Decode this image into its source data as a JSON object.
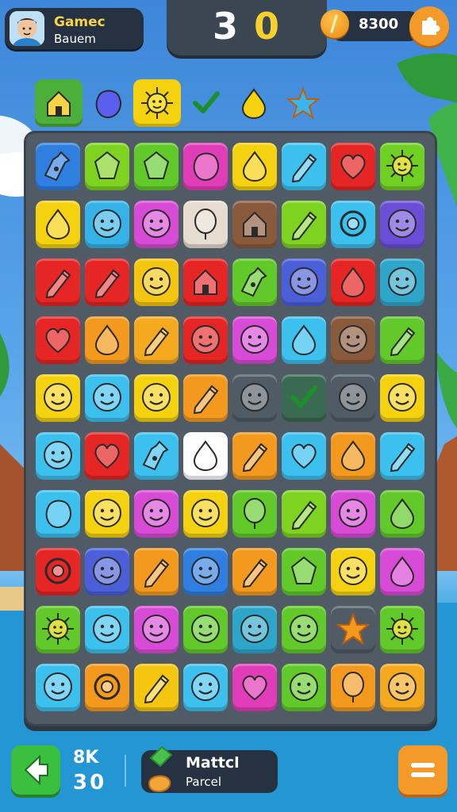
{
  "player": {
    "name": "Gamec",
    "subtitle": "Bauem"
  },
  "score": {
    "digit1": "3",
    "digit2": "0"
  },
  "coins": {
    "value": "8300"
  },
  "goals": [
    "house",
    "blob",
    "sun",
    "check",
    "drop",
    "star"
  ],
  "board": {
    "rows": [
      [
        {
          "c": "#2f7fe0",
          "i": "bottle"
        },
        {
          "c": "#7ed321",
          "i": "gem"
        },
        {
          "c": "#62c92a",
          "i": "gem"
        },
        {
          "c": "#e23db8",
          "i": "blob"
        },
        {
          "c": "#f5d20f",
          "i": "drop"
        },
        {
          "c": "#3cc0ee",
          "i": "pencil"
        },
        {
          "c": "#e62525",
          "i": "heart"
        },
        {
          "c": "#6fcf23",
          "i": "sun"
        }
      ],
      [
        {
          "c": "#f5d20f",
          "i": "drop"
        },
        {
          "c": "#35b3e8",
          "i": "face"
        },
        {
          "c": "#d84bd6",
          "i": "face"
        },
        {
          "c": "#e6dcd0",
          "i": "balloon"
        },
        {
          "c": "#8a5a3c",
          "i": "house"
        },
        {
          "c": "#7ed321",
          "i": "pencil"
        },
        {
          "c": "#3cc0ee",
          "i": "ring"
        },
        {
          "c": "#6a4ed8",
          "i": "face"
        }
      ],
      [
        {
          "c": "#e62525",
          "i": "pencil"
        },
        {
          "c": "#e62525",
          "i": "pencil"
        },
        {
          "c": "#f5c60f",
          "i": "face"
        },
        {
          "c": "#e62525",
          "i": "house"
        },
        {
          "c": "#62c92a",
          "i": "bottle"
        },
        {
          "c": "#4a5fd8",
          "i": "face"
        },
        {
          "c": "#e62525",
          "i": "drop"
        },
        {
          "c": "#2ea6c9",
          "i": "face"
        }
      ],
      [
        {
          "c": "#e62525",
          "i": "heart"
        },
        {
          "c": "#f39a1e",
          "i": "drop"
        },
        {
          "c": "#f5a91e",
          "i": "pencil"
        },
        {
          "c": "#e62525",
          "i": "face"
        },
        {
          "c": "#d84bd6",
          "i": "face"
        },
        {
          "c": "#3cc0ee",
          "i": "drop"
        },
        {
          "c": "#8a5a3c",
          "i": "face"
        },
        {
          "c": "#62c92a",
          "i": "pencil"
        }
      ],
      [
        {
          "c": "#f5d20f",
          "i": "face"
        },
        {
          "c": "#3cc0ee",
          "i": "face"
        },
        {
          "c": "#f5d20f",
          "i": "face"
        },
        {
          "c": "#f39a1e",
          "i": "pencil"
        },
        {
          "c": "#505b66",
          "i": "face"
        },
        {
          "c": "#3a6a52",
          "i": "check"
        },
        {
          "c": "#505b66",
          "i": "face"
        },
        {
          "c": "#f5d20f",
          "i": "face"
        }
      ],
      [
        {
          "c": "#3cc0ee",
          "i": "face"
        },
        {
          "c": "#e62525",
          "i": "heart"
        },
        {
          "c": "#3cc0ee",
          "i": "bottle"
        },
        {
          "c": "#ffffff",
          "i": "drop"
        },
        {
          "c": "#f39a1e",
          "i": "pencil"
        },
        {
          "c": "#3cc0ee",
          "i": "heart"
        },
        {
          "c": "#f39a1e",
          "i": "drop"
        },
        {
          "c": "#3cc0ee",
          "i": "pencil"
        }
      ],
      [
        {
          "c": "#3cc0ee",
          "i": "blob"
        },
        {
          "c": "#f5d20f",
          "i": "face"
        },
        {
          "c": "#d84bd6",
          "i": "face"
        },
        {
          "c": "#f5d20f",
          "i": "face"
        },
        {
          "c": "#62c92a",
          "i": "balloon"
        },
        {
          "c": "#7ed321",
          "i": "pencil"
        },
        {
          "c": "#d84bd6",
          "i": "face"
        },
        {
          "c": "#62c92a",
          "i": "drop"
        }
      ],
      [
        {
          "c": "#e62525",
          "i": "ring"
        },
        {
          "c": "#4a5fd8",
          "i": "face"
        },
        {
          "c": "#f39a1e",
          "i": "pencil"
        },
        {
          "c": "#2f7fe0",
          "i": "face"
        },
        {
          "c": "#f39a1e",
          "i": "pencil"
        },
        {
          "c": "#62c92a",
          "i": "gem"
        },
        {
          "c": "#f5d20f",
          "i": "face"
        },
        {
          "c": "#d84bd6",
          "i": "drop"
        }
      ],
      [
        {
          "c": "#62c92a",
          "i": "sun"
        },
        {
          "c": "#3cc0ee",
          "i": "face"
        },
        {
          "c": "#d84bd6",
          "i": "face"
        },
        {
          "c": "#62c92a",
          "i": "face"
        },
        {
          "c": "#2ea6c9",
          "i": "face"
        },
        {
          "c": "#62c92a",
          "i": "face"
        },
        {
          "c": "#505b66",
          "i": "star"
        },
        {
          "c": "#62c92a",
          "i": "sun"
        }
      ],
      [
        {
          "c": "#3cc0ee",
          "i": "face"
        },
        {
          "c": "#f39a1e",
          "i": "ring"
        },
        {
          "c": "#f5c60f",
          "i": "pencil"
        },
        {
          "c": "#3cc0ee",
          "i": "face"
        },
        {
          "c": "#e23db8",
          "i": "heart"
        },
        {
          "c": "#62c92a",
          "i": "face"
        },
        {
          "c": "#f39a1e",
          "i": "balloon"
        },
        {
          "c": "#f5a91e",
          "i": "face"
        }
      ]
    ]
  },
  "moves": {
    "label": "8K",
    "value": "30"
  },
  "match": {
    "title": "Mattcl",
    "subtitle": "Parcel"
  }
}
